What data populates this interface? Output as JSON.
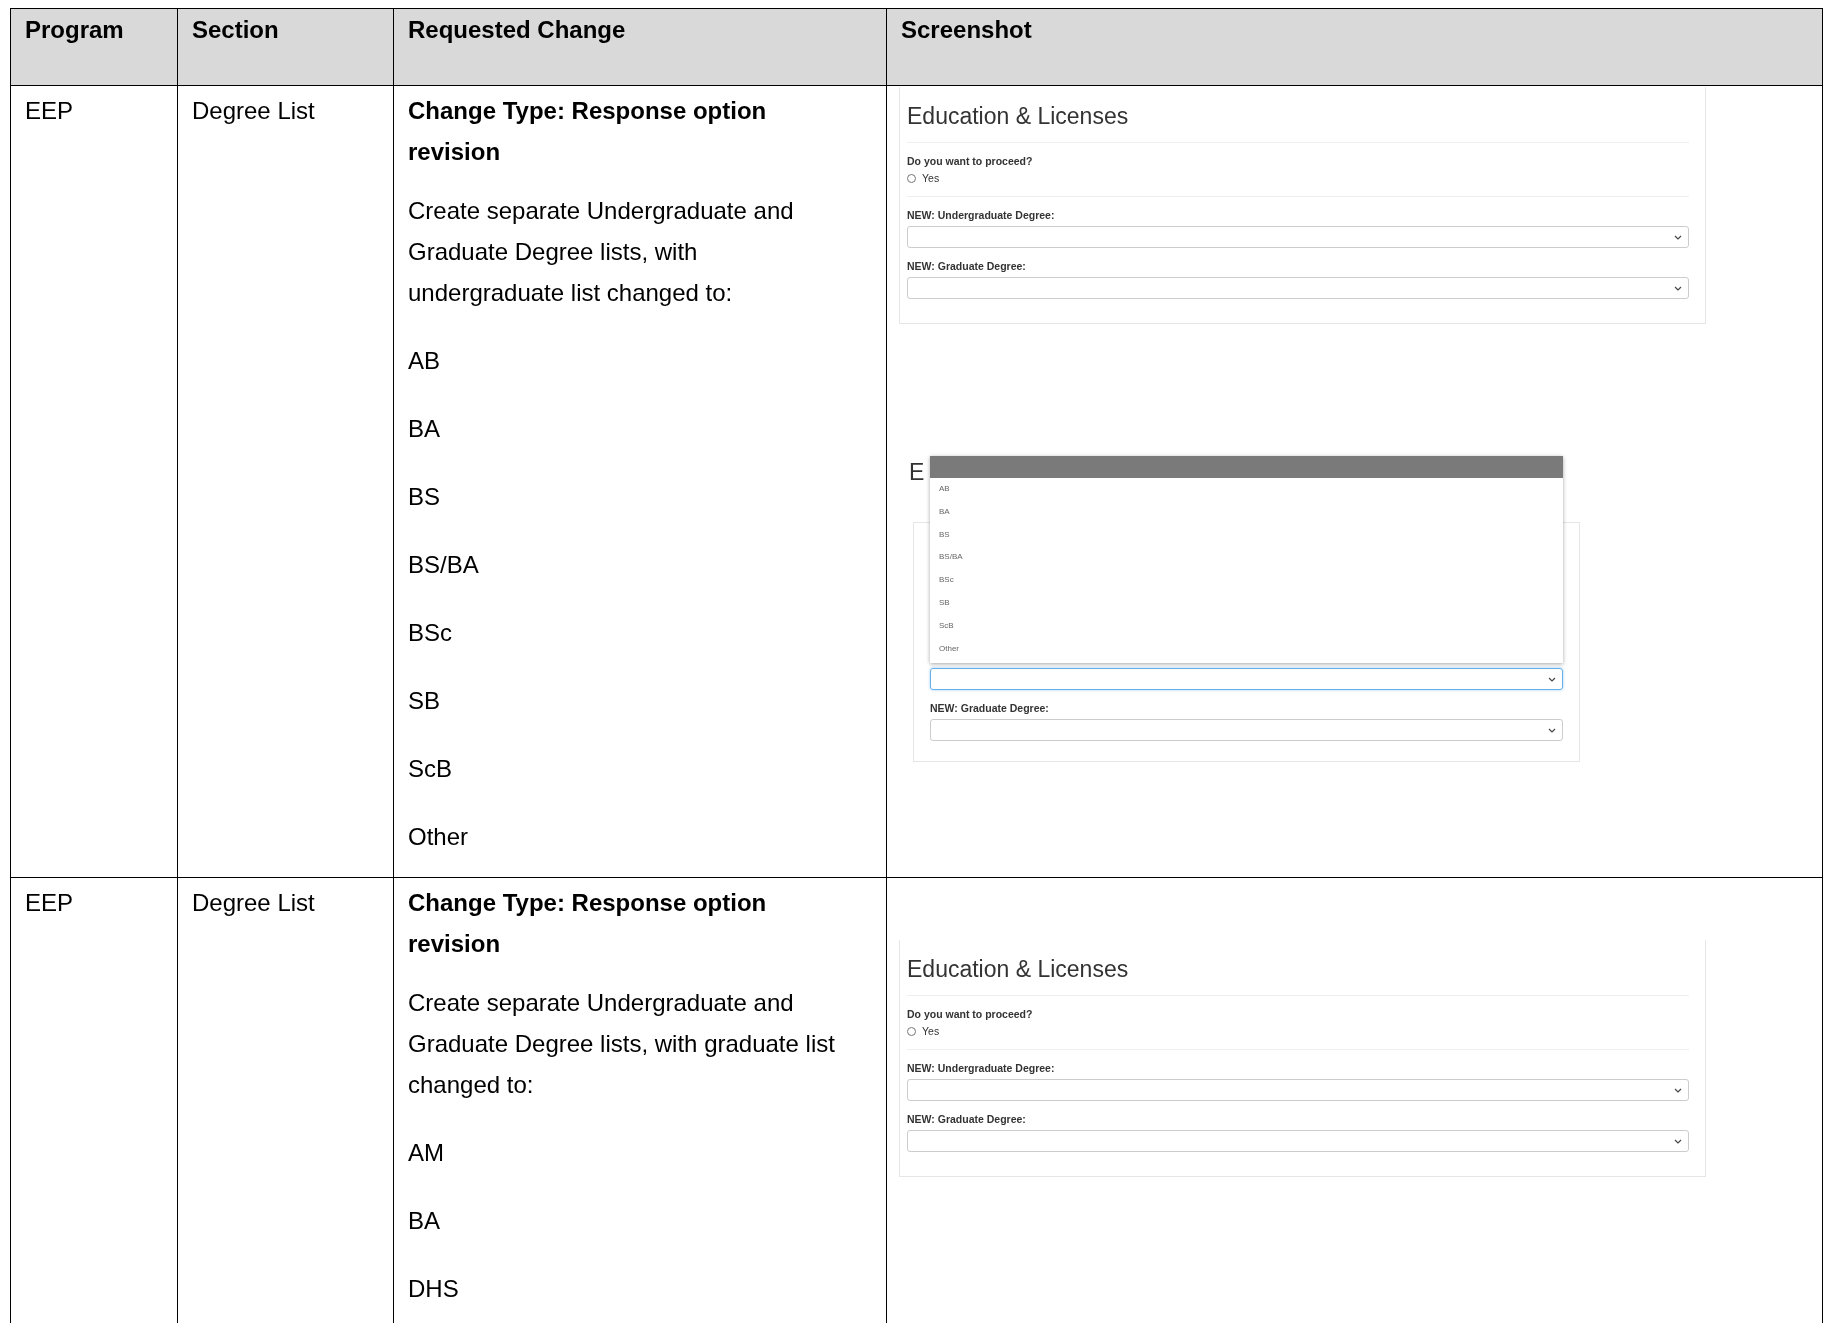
{
  "columns": [
    "Program",
    "Section",
    "Requested Change",
    "Screenshot"
  ],
  "rows": [
    {
      "program": "EEP",
      "section": "Degree List",
      "change_type": "Change Type: Response option revision",
      "description": "Create separate Undergraduate and Graduate Degree lists, with undergraduate list changed to:",
      "options": [
        "AB",
        "BA",
        "BS",
        "BS/BA",
        "BSc",
        "SB",
        "ScB",
        "Other"
      ],
      "screenshots": [
        {
          "kind": "form",
          "title": "Education & Licenses",
          "question": "Do you want to proceed?",
          "radio": {
            "label": "Yes",
            "checked": false
          },
          "fields": [
            {
              "label": "NEW: Undergraduate Degree:",
              "focused": false
            },
            {
              "label": "NEW: Graduate Degree:",
              "focused": false
            }
          ]
        },
        {
          "kind": "dropdown",
          "title": "E",
          "list": [
            "AB",
            "BA",
            "BS",
            "BS/BA",
            "BSc",
            "SB",
            "ScB",
            "Other"
          ],
          "fields": [
            {
              "label": "NEW: Graduate Degree:",
              "focused": false
            }
          ],
          "open_field": {
            "focused": true
          }
        }
      ]
    },
    {
      "program": "EEP",
      "section": "Degree List",
      "change_type": "Change Type: Response option revision",
      "description": "Create separate Undergraduate and Graduate Degree lists, with graduate list changed to:",
      "options": [
        "AM",
        "BA",
        "DHS"
      ],
      "screenshots": [
        {
          "kind": "form",
          "title": "Education & Licenses",
          "question": "Do you want to proceed?",
          "radio": {
            "label": "Yes",
            "checked": false
          },
          "fields": [
            {
              "label": "NEW: Undergraduate Degree:",
              "focused": false
            },
            {
              "label": "NEW: Graduate Degree:",
              "focused": false
            }
          ]
        }
      ]
    }
  ]
}
